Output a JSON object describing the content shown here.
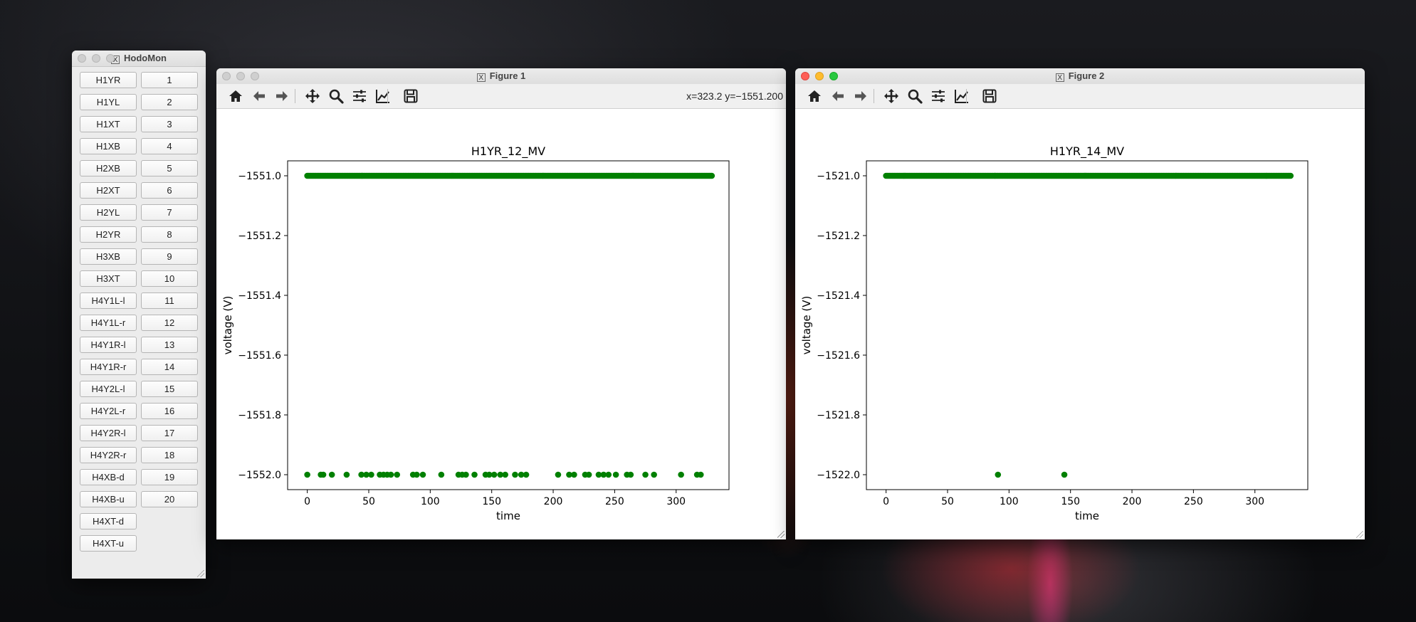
{
  "hodomon": {
    "title": "HodoMon",
    "name_buttons": [
      "H1YR",
      "H1YL",
      "H1XT",
      "H1XB",
      "H2XB",
      "H2XT",
      "H2YL",
      "H2YR",
      "H3XB",
      "H3XT",
      "H4Y1L-l",
      "H4Y1L-r",
      "H4Y1R-l",
      "H4Y1R-r",
      "H4Y2L-l",
      "H4Y2L-r",
      "H4Y2R-l",
      "H4Y2R-r",
      "H4XB-d",
      "H4XB-u",
      "H4XT-d",
      "H4XT-u"
    ],
    "number_buttons": [
      "1",
      "2",
      "3",
      "4",
      "5",
      "6",
      "7",
      "8",
      "9",
      "10",
      "11",
      "12",
      "13",
      "14",
      "15",
      "16",
      "17",
      "18",
      "19",
      "20"
    ]
  },
  "figure1": {
    "title": "Figure 1",
    "coords": "x=323.2 y=−1551.200",
    "toolbar_icons": [
      "home-icon",
      "back-icon",
      "forward-icon",
      "pan-icon",
      "zoom-icon",
      "subplots-icon",
      "edit-axes-icon",
      "save-icon"
    ]
  },
  "figure2": {
    "title": "Figure 2",
    "toolbar_icons": [
      "home-icon",
      "back-icon",
      "forward-icon",
      "pan-icon",
      "zoom-icon",
      "subplots-icon",
      "edit-axes-icon",
      "save-icon"
    ]
  },
  "chart_data": [
    {
      "type": "scatter",
      "title": "H1YR_12_MV",
      "xlabel": "time",
      "ylabel": "voltage (V)",
      "xlim": [
        -16,
        343
      ],
      "ylim": [
        -1552.05,
        -1550.95
      ],
      "xticks": [
        0,
        50,
        100,
        150,
        200,
        250,
        300
      ],
      "yticks": [
        -1551.0,
        -1551.2,
        -1551.4,
        -1551.6,
        -1551.8,
        -1552.0
      ],
      "ytick_labels": [
        "−1551.0",
        "−1551.2",
        "−1551.4",
        "−1551.6",
        "−1551.8",
        "−1552.0"
      ],
      "color": "#008000",
      "series": [
        {
          "x_range": [
            0,
            329
          ],
          "y": -1551.0
        },
        {
          "x": [
            0,
            11,
            13,
            20,
            32,
            44,
            48,
            52,
            59,
            62,
            65,
            68,
            73,
            86,
            89,
            94,
            109,
            123,
            126,
            129,
            136,
            145,
            148,
            152,
            157,
            161,
            169,
            174,
            178,
            204,
            213,
            217,
            226,
            229,
            237,
            241,
            245,
            251,
            260,
            263,
            275,
            282,
            304,
            317,
            320
          ],
          "y": -1552.0
        }
      ]
    },
    {
      "type": "scatter",
      "title": "H1YR_14_MV",
      "xlabel": "time",
      "ylabel": "voltage (V)",
      "xlim": [
        -16,
        343
      ],
      "ylim": [
        -1522.05,
        -1520.95
      ],
      "xticks": [
        0,
        50,
        100,
        150,
        200,
        250,
        300
      ],
      "yticks": [
        -1521.0,
        -1521.2,
        -1521.4,
        -1521.6,
        -1521.8,
        -1522.0
      ],
      "ytick_labels": [
        "−1521.0",
        "−1521.2",
        "−1521.4",
        "−1521.6",
        "−1521.8",
        "−1522.0"
      ],
      "color": "#008000",
      "series": [
        {
          "x_range": [
            0,
            329
          ],
          "y": -1521.0
        },
        {
          "x": [
            91,
            145
          ],
          "y": -1522.0
        }
      ]
    }
  ]
}
